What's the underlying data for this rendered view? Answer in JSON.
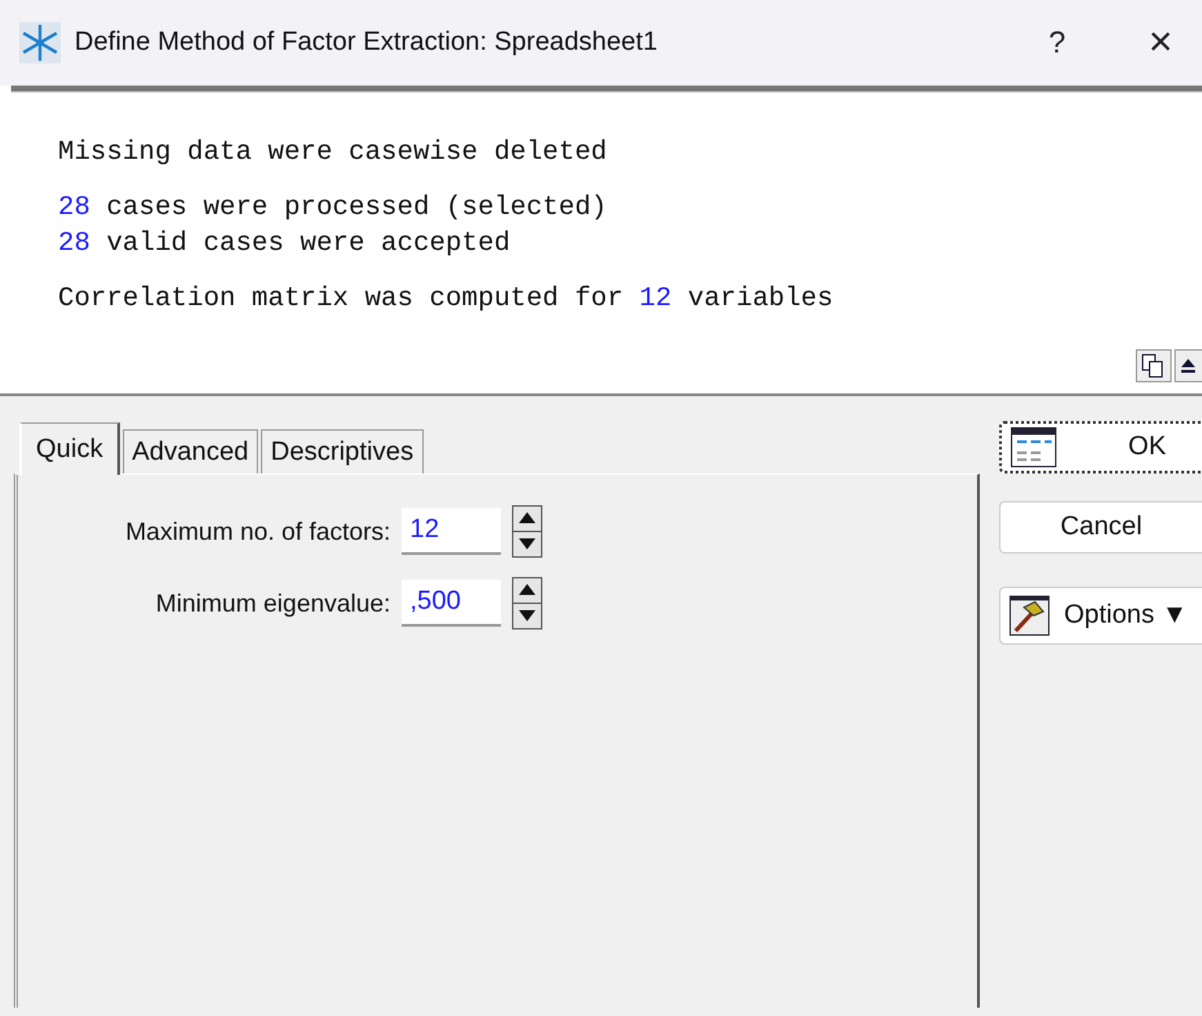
{
  "window": {
    "title": "Define Method of Factor Extraction: Spreadsheet1",
    "help": "?",
    "close": "×"
  },
  "output": [
    [
      {
        "kind": "text",
        "text": "Missing data were casewise deleted"
      }
    ],
    [
      {
        "kind": "number",
        "text": "28"
      },
      {
        "kind": "text",
        "text": " cases were processed (selected)"
      }
    ],
    [
      {
        "kind": "number",
        "text": "28"
      },
      {
        "kind": "text",
        "text": " valid cases were accepted"
      }
    ],
    [
      {
        "kind": "text",
        "text": "Correlation matrix was computed for "
      },
      {
        "kind": "number",
        "text": "12"
      },
      {
        "kind": "text",
        "text": " variables"
      }
    ]
  ],
  "tabs": [
    {
      "label": "Quick",
      "selected": true
    },
    {
      "label": "Advanced",
      "selected": false
    },
    {
      "label": "Descriptives",
      "selected": false
    }
  ],
  "fields": [
    {
      "label": "Maximum no. of factors:",
      "value": "12"
    },
    {
      "label": "Minimum eigenvalue:",
      "value": ",500"
    }
  ],
  "buttons": [
    {
      "kind": "ok",
      "label": "OK"
    },
    {
      "kind": "cancel",
      "label": "Cancel"
    },
    {
      "kind": "options",
      "label": "Options",
      "caret": "▼"
    }
  ]
}
